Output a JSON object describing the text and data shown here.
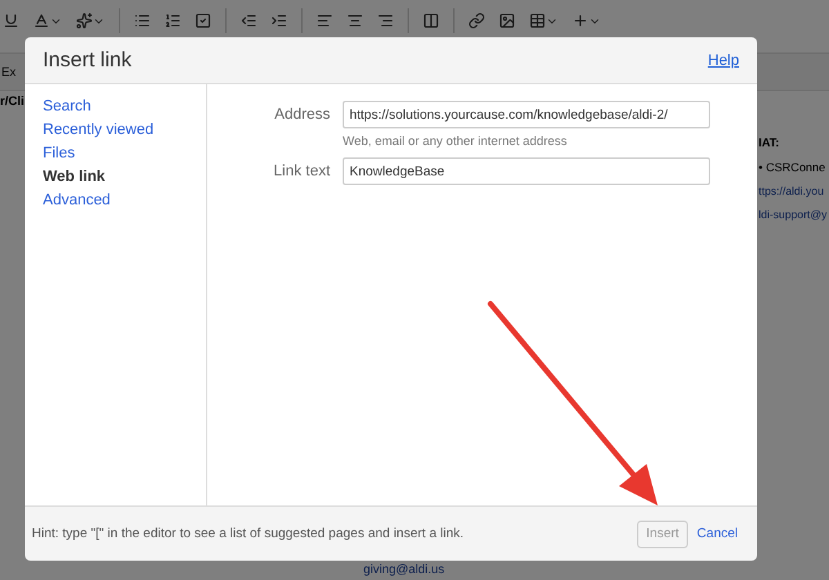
{
  "editor": {
    "toolbar_button": "Ex",
    "left_heading": "r/Cli",
    "right_heading": "IAT:",
    "bullet": "CSRConne",
    "bullet_mark": "•",
    "links": [
      "ttps://aldi.you",
      "ldi-support@y"
    ],
    "bottom_link": "giving@aldi.us"
  },
  "dialog": {
    "title": "Insert link",
    "help": "Help",
    "nav": [
      {
        "label": "Search",
        "selected": false
      },
      {
        "label": "Recently viewed",
        "selected": false
      },
      {
        "label": "Files",
        "selected": false
      },
      {
        "label": "Web link",
        "selected": true
      },
      {
        "label": "Advanced",
        "selected": false
      }
    ],
    "fields": [
      {
        "label": "Address",
        "value": "https://solutions.yourcause.com/knowledgebase/aldi-2/",
        "hint": "Web, email or any other internet address"
      },
      {
        "label": "Link text",
        "value": "KnowledgeBase"
      }
    ],
    "footer_hint": "Hint: type \"[\" in the editor to see a list of suggested pages and insert a link.",
    "insert": {
      "label": "Insert",
      "disabled": true
    },
    "cancel": "Cancel"
  }
}
